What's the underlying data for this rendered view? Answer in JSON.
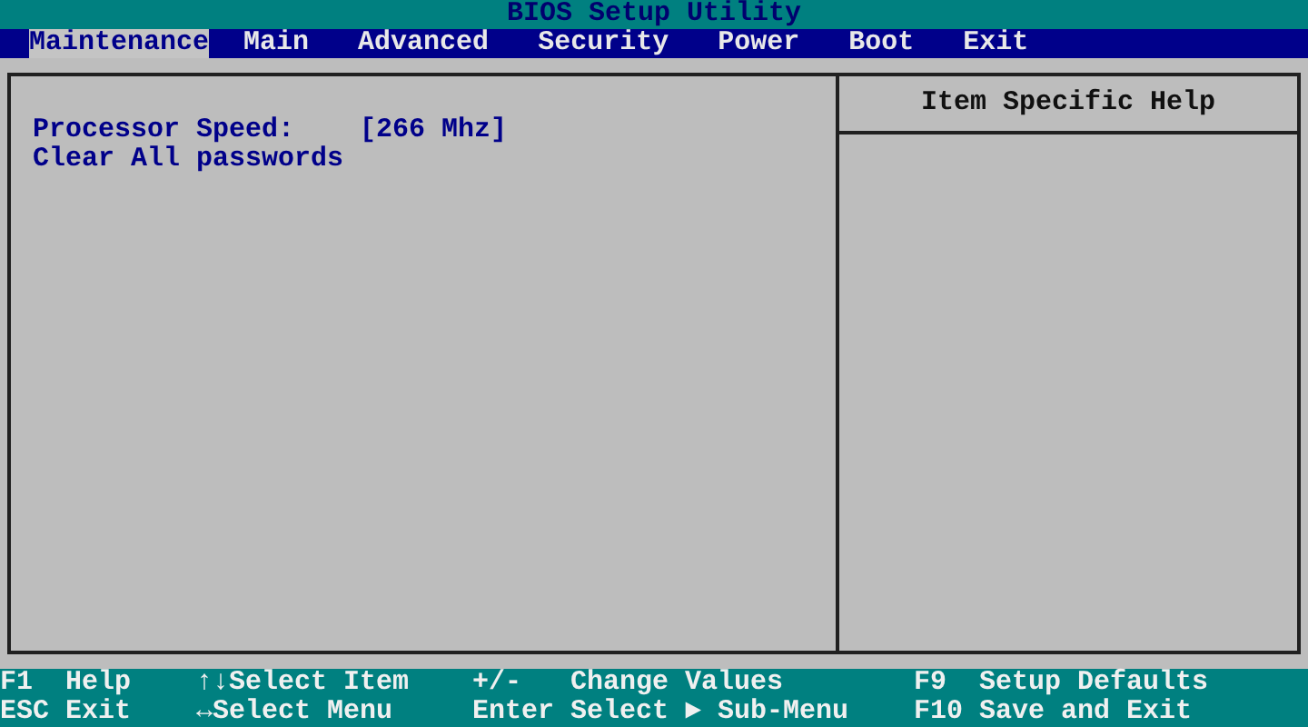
{
  "window": {
    "title": "BIOS Setup Utility"
  },
  "tabs": [
    {
      "label": "Maintenance",
      "selected": true
    },
    {
      "label": "Main",
      "selected": false
    },
    {
      "label": "Advanced",
      "selected": false
    },
    {
      "label": "Security",
      "selected": false
    },
    {
      "label": "Power",
      "selected": false
    },
    {
      "label": "Boot",
      "selected": false
    },
    {
      "label": "Exit",
      "selected": false
    }
  ],
  "settings": [
    {
      "label": "Processor Speed:",
      "value": "[266 Mhz]"
    },
    {
      "label": "Clear All passwords"
    }
  ],
  "help_panel": {
    "title": "Item Specific Help"
  },
  "status_bar": [
    [
      {
        "key": "F1",
        "action": "Help"
      },
      {
        "key": "↑↓",
        "action": "Select Item"
      },
      {
        "key": "+/-",
        "action": "Change Values"
      },
      {
        "key": "F9",
        "action": "Setup Defaults"
      }
    ],
    [
      {
        "key": "ESC",
        "action": "Exit"
      },
      {
        "key": "↔",
        "action": "Select Menu"
      },
      {
        "key": "Enter",
        "action": "Select ► Sub-Menu"
      },
      {
        "key": "F10",
        "action": "Save and Exit"
      }
    ]
  ]
}
